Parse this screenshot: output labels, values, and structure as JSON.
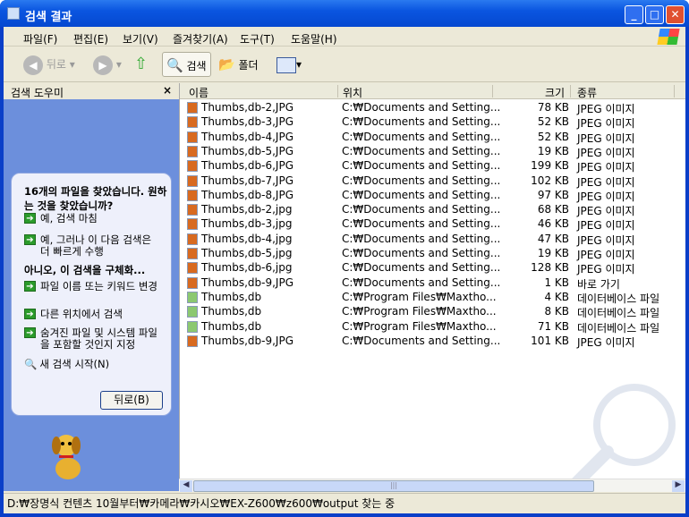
{
  "window": {
    "title": "검색 결과",
    "controls": [
      "_",
      "□",
      "✕"
    ]
  },
  "menu": [
    "파일(F)",
    "편집(E)",
    "보기(V)",
    "즐겨찾기(A)",
    "도구(T)",
    "도움말(H)"
  ],
  "toolbar": {
    "back": "뒤로",
    "search": "검색",
    "folders": "폴더"
  },
  "left_panel": {
    "title": "검색 도우미",
    "close": "×",
    "heading1": "16개의 파일을 찾았습니다. 원하는 것을 찾았습니까?",
    "yes_done": "예, 검색 마침",
    "yes_faster": "예, 그러나 이 다음 검색은 더 빠르게 수행",
    "heading2": "아니오, 이 검색을 구체화...",
    "change_name": "파일 이름 또는 키워드 변경",
    "other_location": "다른 위치에서 검색",
    "hidden_files": "숨겨진 파일 및 시스템 파일을 포함할 것인지 지정",
    "new_search": "새 검색 시작(N)",
    "back_button": "뒤로(B)"
  },
  "columns": [
    "이름",
    "위치",
    "크기",
    "종류"
  ],
  "files": [
    {
      "name": "Thumbs,db-2,JPG",
      "loc": "C:₩Documents and Setting...",
      "size": "78 KB",
      "type": "JPEG 이미지",
      "icon": "jpeg"
    },
    {
      "name": "Thumbs,db-3,JPG",
      "loc": "C:₩Documents and Setting...",
      "size": "52 KB",
      "type": "JPEG 이미지",
      "icon": "jpeg"
    },
    {
      "name": "Thumbs,db-4,JPG",
      "loc": "C:₩Documents and Setting...",
      "size": "52 KB",
      "type": "JPEG 이미지",
      "icon": "jpeg"
    },
    {
      "name": "Thumbs,db-5,JPG",
      "loc": "C:₩Documents and Setting...",
      "size": "19 KB",
      "type": "JPEG 이미지",
      "icon": "jpeg"
    },
    {
      "name": "Thumbs,db-6,JPG",
      "loc": "C:₩Documents and Setting...",
      "size": "199 KB",
      "type": "JPEG 이미지",
      "icon": "jpeg"
    },
    {
      "name": "Thumbs,db-7,JPG",
      "loc": "C:₩Documents and Setting...",
      "size": "102 KB",
      "type": "JPEG 이미지",
      "icon": "jpeg"
    },
    {
      "name": "Thumbs,db-8,JPG",
      "loc": "C:₩Documents and Setting...",
      "size": "97 KB",
      "type": "JPEG 이미지",
      "icon": "jpeg"
    },
    {
      "name": "Thumbs,db-2,jpg",
      "loc": "C:₩Documents and Setting...",
      "size": "68 KB",
      "type": "JPEG 이미지",
      "icon": "jpeg"
    },
    {
      "name": "Thumbs,db-3,jpg",
      "loc": "C:₩Documents and Setting...",
      "size": "46 KB",
      "type": "JPEG 이미지",
      "icon": "jpeg"
    },
    {
      "name": "Thumbs,db-4,jpg",
      "loc": "C:₩Documents and Setting...",
      "size": "47 KB",
      "type": "JPEG 이미지",
      "icon": "jpeg"
    },
    {
      "name": "Thumbs,db-5,jpg",
      "loc": "C:₩Documents and Setting...",
      "size": "19 KB",
      "type": "JPEG 이미지",
      "icon": "jpeg"
    },
    {
      "name": "Thumbs,db-6,jpg",
      "loc": "C:₩Documents and Setting...",
      "size": "128 KB",
      "type": "JPEG 이미지",
      "icon": "jpeg"
    },
    {
      "name": "Thumbs,db-9,JPG",
      "loc": "C:₩Documents and Setting...",
      "size": "1 KB",
      "type": "바로 가기",
      "icon": "jpeg"
    },
    {
      "name": "Thumbs,db",
      "loc": "C:₩Program Files₩Maxtho...",
      "size": "4 KB",
      "type": "데이터베이스 파일",
      "icon": "db"
    },
    {
      "name": "Thumbs,db",
      "loc": "C:₩Program Files₩Maxtho...",
      "size": "8 KB",
      "type": "데이터베이스 파일",
      "icon": "db"
    },
    {
      "name": "Thumbs,db",
      "loc": "C:₩Program Files₩Maxtho...",
      "size": "71 KB",
      "type": "데이터베이스 파일",
      "icon": "db"
    },
    {
      "name": "Thumbs,db-9,JPG",
      "loc": "C:₩Documents and Setting...",
      "size": "101 KB",
      "type": "JPEG 이미지",
      "icon": "jpeg"
    }
  ],
  "status": "D:₩장명식 컨텐츠 10월부터₩카메라₩카시오₩EX-Z600₩z600₩output 찾는 중"
}
